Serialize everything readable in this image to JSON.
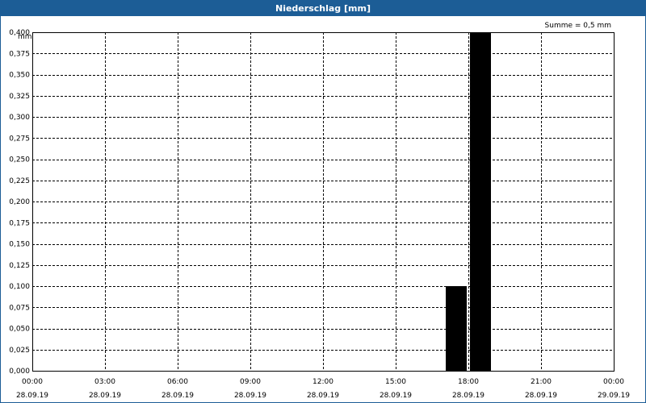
{
  "window": {
    "title": "Niederschlag [mm]"
  },
  "chart_data": {
    "type": "bar",
    "title": "Niederschlag [mm]",
    "ylabel": "mm",
    "annotation": "Summe = 0,5 mm",
    "ylim": [
      0,
      0.4
    ],
    "y_ticks": [
      "0,000",
      "0,025",
      "0,050",
      "0,075",
      "0,100",
      "0,125",
      "0,150",
      "0,175",
      "0,200",
      "0,225",
      "0,250",
      "0,275",
      "0,300",
      "0,325",
      "0,350",
      "0,375",
      "0,400"
    ],
    "x_ticks": [
      {
        "time": "00:00",
        "date": "28.09.19"
      },
      {
        "time": "03:00",
        "date": "28.09.19"
      },
      {
        "time": "06:00",
        "date": "28.09.19"
      },
      {
        "time": "09:00",
        "date": "28.09.19"
      },
      {
        "time": "12:00",
        "date": "28.09.19"
      },
      {
        "time": "15:00",
        "date": "28.09.19"
      },
      {
        "time": "18:00",
        "date": "28.09.19"
      },
      {
        "time": "21:00",
        "date": "28.09.19"
      },
      {
        "time": "00:00",
        "date": "29.09.19"
      }
    ],
    "xlim_hours": [
      0,
      24
    ],
    "bars": [
      {
        "start_hour": 17.0,
        "end_hour": 18.0,
        "value": 0.1
      },
      {
        "start_hour": 18.0,
        "end_hour": 19.0,
        "value": 0.4
      }
    ],
    "grid": true,
    "colors": {
      "bar": "#000000",
      "titlebar": "#1c5d96",
      "grid": "#000000"
    }
  }
}
